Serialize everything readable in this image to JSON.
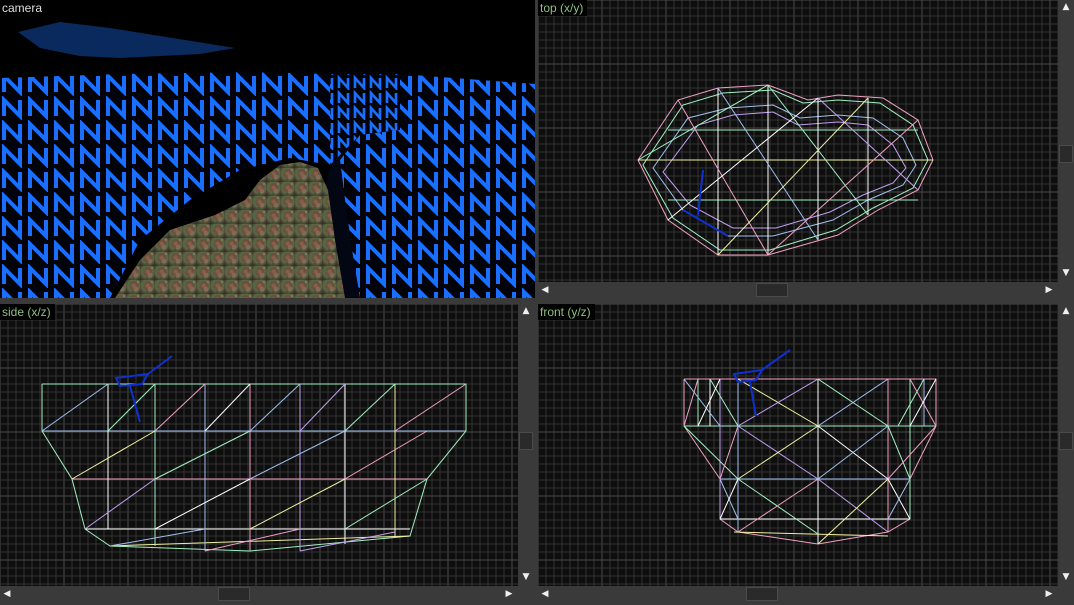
{
  "viewports": {
    "camera": {
      "label": "camera"
    },
    "top": {
      "label": "top (x/y)"
    },
    "side": {
      "label": "side (x/z)"
    },
    "front": {
      "label": "front (y/z)"
    }
  },
  "icons": {
    "scroll_up": "▲",
    "scroll_down": "▼",
    "scroll_left": "◀",
    "scroll_right": "▶"
  },
  "colors": {
    "viewport_background": "#0e0e0e",
    "grid_minor": "#333333",
    "grid_major": "#4a4a4a",
    "wall_texture": "#1a6fff",
    "sky": "#0a2a5e",
    "brush_lines": [
      "#f0a0c0",
      "#a0f0c0",
      "#a0c0f0",
      "#f0f0a0",
      "#c0a0f0",
      "#ffffff"
    ],
    "entity": "#1030d0",
    "view_label_text": "#8fbf7f"
  }
}
